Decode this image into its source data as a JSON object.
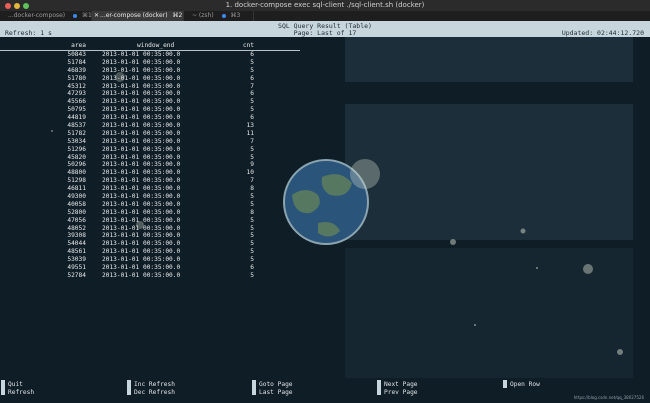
{
  "window": {
    "title": "1. docker-compose exec sql-client ./sql-client.sh (docker)"
  },
  "tabs": [
    {
      "label": "...docker-compose)",
      "shortcut": "⌘1",
      "active": false
    },
    {
      "label": "...er-compose (docker)",
      "shortcut": "⌘2",
      "active": true
    },
    {
      "label": "~ (zsh)",
      "shortcut": "⌘3",
      "active": false
    }
  ],
  "header": {
    "title": "SQL Query Result (Table)",
    "refresh": "Refresh: 1 s",
    "page": "Page: Last of 17",
    "updated": "Updated: 02:44:12.720"
  },
  "table": {
    "columns": [
      "area",
      "window_end",
      "cnt"
    ],
    "rows": [
      [
        "50843",
        "2013-01-01 00:35:00.0",
        "6"
      ],
      [
        "51784",
        "2013-01-01 00:35:00.0",
        "5"
      ],
      [
        "46839",
        "2013-01-01 00:35:00.0",
        "5"
      ],
      [
        "51780",
        "2013-01-01 00:35:00.0",
        "6"
      ],
      [
        "45312",
        "2013-01-01 00:35:00.0",
        "7"
      ],
      [
        "47293",
        "2013-01-01 00:35:00.0",
        "6"
      ],
      [
        "45566",
        "2013-01-01 00:35:00.0",
        "5"
      ],
      [
        "50795",
        "2013-01-01 00:35:00.0",
        "5"
      ],
      [
        "44819",
        "2013-01-01 00:35:00.0",
        "6"
      ],
      [
        "48537",
        "2013-01-01 00:35:00.0",
        "13"
      ],
      [
        "51782",
        "2013-01-01 00:35:00.0",
        "11"
      ],
      [
        "53034",
        "2013-01-01 00:35:00.0",
        "7"
      ],
      [
        "51296",
        "2013-01-01 00:35:00.0",
        "5"
      ],
      [
        "45820",
        "2013-01-01 00:35:00.0",
        "5"
      ],
      [
        "50296",
        "2013-01-01 00:35:00.0",
        "9"
      ],
      [
        "48800",
        "2013-01-01 00:35:00.0",
        "10"
      ],
      [
        "51298",
        "2013-01-01 00:35:00.0",
        "7"
      ],
      [
        "46811",
        "2013-01-01 00:35:00.0",
        "8"
      ],
      [
        "49300",
        "2013-01-01 00:35:00.0",
        "5"
      ],
      [
        "40058",
        "2013-01-01 00:35:00.0",
        "5"
      ],
      [
        "52800",
        "2013-01-01 00:35:00.0",
        "8"
      ],
      [
        "47056",
        "2013-01-01 00:35:00.0",
        "5"
      ],
      [
        "48052",
        "2013-01-01 00:35:00.0",
        "5"
      ],
      [
        "39308",
        "2013-01-01 00:35:00.0",
        "5"
      ],
      [
        "54044",
        "2013-01-01 00:35:00.0",
        "5"
      ],
      [
        "48561",
        "2013-01-01 00:35:00.0",
        "5"
      ],
      [
        "53039",
        "2013-01-01 00:35:00.0",
        "5"
      ],
      [
        "49551",
        "2013-01-01 00:35:00.0",
        "6"
      ],
      [
        "52784",
        "2013-01-01 00:35:00.0",
        "5"
      ]
    ]
  },
  "footer": {
    "keys": [
      {
        "key": "Q",
        "line1": "Quit",
        "line2": "Refresh"
      },
      {
        "key": "+",
        "line1": "Inc Refresh",
        "line2": "Dec Refresh"
      },
      {
        "key": "G",
        "line1": "Goto Page",
        "line2": "Last Page"
      },
      {
        "key": "N",
        "line1": "Next Page",
        "line2": "Prev Page"
      },
      {
        "key": "O",
        "line1": "Open Row",
        "line2": ""
      }
    ]
  },
  "watermark": "https://blog.csdn.net/qq_38027526",
  "colors": {
    "background": "#0f1d26",
    "header_bg": "#c7d5dd",
    "tab_indicator": "#3a87ff"
  }
}
